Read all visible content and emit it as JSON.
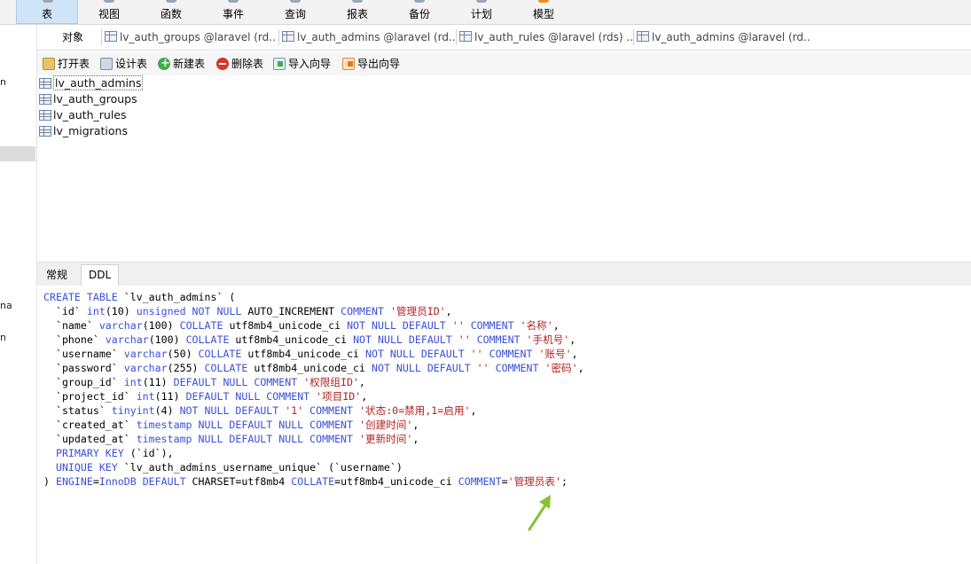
{
  "toolbar": {
    "items": [
      {
        "label": "表",
        "active": true
      },
      {
        "label": "视图"
      },
      {
        "label": "函数"
      },
      {
        "label": "事件"
      },
      {
        "label": "查询"
      },
      {
        "label": "报表"
      },
      {
        "label": "备份"
      },
      {
        "label": "计划"
      },
      {
        "label": "模型"
      }
    ]
  },
  "sidebar": {
    "fragments": [
      "n",
      "na",
      "n"
    ]
  },
  "tabs": {
    "objects": "对象",
    "open": [
      "lv_auth_groups @laravel (rd...",
      "lv_auth_admins @laravel (rd...",
      "lv_auth_rules @laravel (rds) ...",
      "lv_auth_admins @laravel (rd..."
    ]
  },
  "object_toolbar": {
    "open": "打开表",
    "design": "设计表",
    "new": "新建表",
    "delete": "删除表",
    "import": "导入向导",
    "export": "导出向导"
  },
  "tables": [
    "lv_auth_admins",
    "lv_auth_groups",
    "lv_auth_rules",
    "lv_migrations"
  ],
  "info_tabs": [
    "常规",
    "DDL"
  ],
  "ddl": {
    "lines": [
      [
        {
          "t": "CREATE TABLE",
          "c": "kw"
        },
        {
          "t": " `lv_auth_admins` ("
        }
      ],
      [
        {
          "t": "  `id` "
        },
        {
          "t": "int",
          "c": "kw"
        },
        {
          "t": "(10) "
        },
        {
          "t": "unsigned NOT NULL",
          "c": "kw"
        },
        {
          "t": " AUTO_INCREMENT "
        },
        {
          "t": "COMMENT",
          "c": "kw"
        },
        {
          "t": " '管理员ID'",
          "c": "st"
        },
        {
          "t": ","
        }
      ],
      [
        {
          "t": "  `name` "
        },
        {
          "t": "varchar",
          "c": "kw"
        },
        {
          "t": "(100) "
        },
        {
          "t": "COLLATE",
          "c": "kw"
        },
        {
          "t": " utf8mb4_unicode_ci "
        },
        {
          "t": "NOT NULL DEFAULT",
          "c": "kw"
        },
        {
          "t": " ''",
          "c": "st"
        },
        {
          "t": " "
        },
        {
          "t": "COMMENT",
          "c": "kw"
        },
        {
          "t": " '名称'",
          "c": "st"
        },
        {
          "t": ","
        }
      ],
      [
        {
          "t": "  `phone` "
        },
        {
          "t": "varchar",
          "c": "kw"
        },
        {
          "t": "(100) "
        },
        {
          "t": "COLLATE",
          "c": "kw"
        },
        {
          "t": " utf8mb4_unicode_ci "
        },
        {
          "t": "NOT NULL DEFAULT",
          "c": "kw"
        },
        {
          "t": " ''",
          "c": "st"
        },
        {
          "t": " "
        },
        {
          "t": "COMMENT",
          "c": "kw"
        },
        {
          "t": " '手机号'",
          "c": "st"
        },
        {
          "t": ","
        }
      ],
      [
        {
          "t": "  `username` "
        },
        {
          "t": "varchar",
          "c": "kw"
        },
        {
          "t": "(50) "
        },
        {
          "t": "COLLATE",
          "c": "kw"
        },
        {
          "t": " utf8mb4_unicode_ci "
        },
        {
          "t": "NOT NULL DEFAULT",
          "c": "kw"
        },
        {
          "t": " ''",
          "c": "st"
        },
        {
          "t": " "
        },
        {
          "t": "COMMENT",
          "c": "kw"
        },
        {
          "t": " '账号'",
          "c": "st"
        },
        {
          "t": ","
        }
      ],
      [
        {
          "t": "  `password` "
        },
        {
          "t": "varchar",
          "c": "kw"
        },
        {
          "t": "(255) "
        },
        {
          "t": "COLLATE",
          "c": "kw"
        },
        {
          "t": " utf8mb4_unicode_ci "
        },
        {
          "t": "NOT NULL DEFAULT",
          "c": "kw"
        },
        {
          "t": " ''",
          "c": "st"
        },
        {
          "t": " "
        },
        {
          "t": "COMMENT",
          "c": "kw"
        },
        {
          "t": " '密码'",
          "c": "st"
        },
        {
          "t": ","
        }
      ],
      [
        {
          "t": "  `group_id` "
        },
        {
          "t": "int",
          "c": "kw"
        },
        {
          "t": "(11) "
        },
        {
          "t": "DEFAULT NULL COMMENT",
          "c": "kw"
        },
        {
          "t": " '权限组ID'",
          "c": "st"
        },
        {
          "t": ","
        }
      ],
      [
        {
          "t": "  `project_id` "
        },
        {
          "t": "int",
          "c": "kw"
        },
        {
          "t": "(11) "
        },
        {
          "t": "DEFAULT NULL COMMENT",
          "c": "kw"
        },
        {
          "t": " '项目ID'",
          "c": "st"
        },
        {
          "t": ","
        }
      ],
      [
        {
          "t": "  `status` "
        },
        {
          "t": "tinyint",
          "c": "kw"
        },
        {
          "t": "(4) "
        },
        {
          "t": "NOT NULL DEFAULT",
          "c": "kw"
        },
        {
          "t": " '1'",
          "c": "st"
        },
        {
          "t": " "
        },
        {
          "t": "COMMENT",
          "c": "kw"
        },
        {
          "t": " '状态:0=禁用,1=启用'",
          "c": "st"
        },
        {
          "t": ","
        }
      ],
      [
        {
          "t": "  `created_at` "
        },
        {
          "t": "timestamp NULL DEFAULT NULL COMMENT",
          "c": "kw"
        },
        {
          "t": " '创建时间'",
          "c": "st"
        },
        {
          "t": ","
        }
      ],
      [
        {
          "t": "  `updated_at` "
        },
        {
          "t": "timestamp NULL DEFAULT NULL COMMENT",
          "c": "kw"
        },
        {
          "t": " '更新时间'",
          "c": "st"
        },
        {
          "t": ","
        }
      ],
      [
        {
          "t": "  "
        },
        {
          "t": "PRIMARY KEY",
          "c": "kw"
        },
        {
          "t": " (`id`),"
        }
      ],
      [
        {
          "t": "  "
        },
        {
          "t": "UNIQUE KEY",
          "c": "kw"
        },
        {
          "t": " `lv_auth_admins_username_unique` (`username`)"
        }
      ],
      [
        {
          "t": ") "
        },
        {
          "t": "ENGINE",
          "c": "kw"
        },
        {
          "t": "="
        },
        {
          "t": "InnoDB DEFAULT",
          "c": "kw"
        },
        {
          "t": " CHARSET=utf8mb4 "
        },
        {
          "t": "COLLATE",
          "c": "kw"
        },
        {
          "t": "=utf8mb4_unicode_ci "
        },
        {
          "t": "COMMENT",
          "c": "kw"
        },
        {
          "t": "="
        },
        {
          "t": "'管理员表'",
          "c": "st"
        },
        {
          "t": ";"
        }
      ]
    ]
  },
  "colors": {
    "keyword": "#3b4fd6",
    "string": "#b22222",
    "annotation_arrow": "#86c232"
  },
  "annotation": {
    "icon": "arrow-icon"
  }
}
